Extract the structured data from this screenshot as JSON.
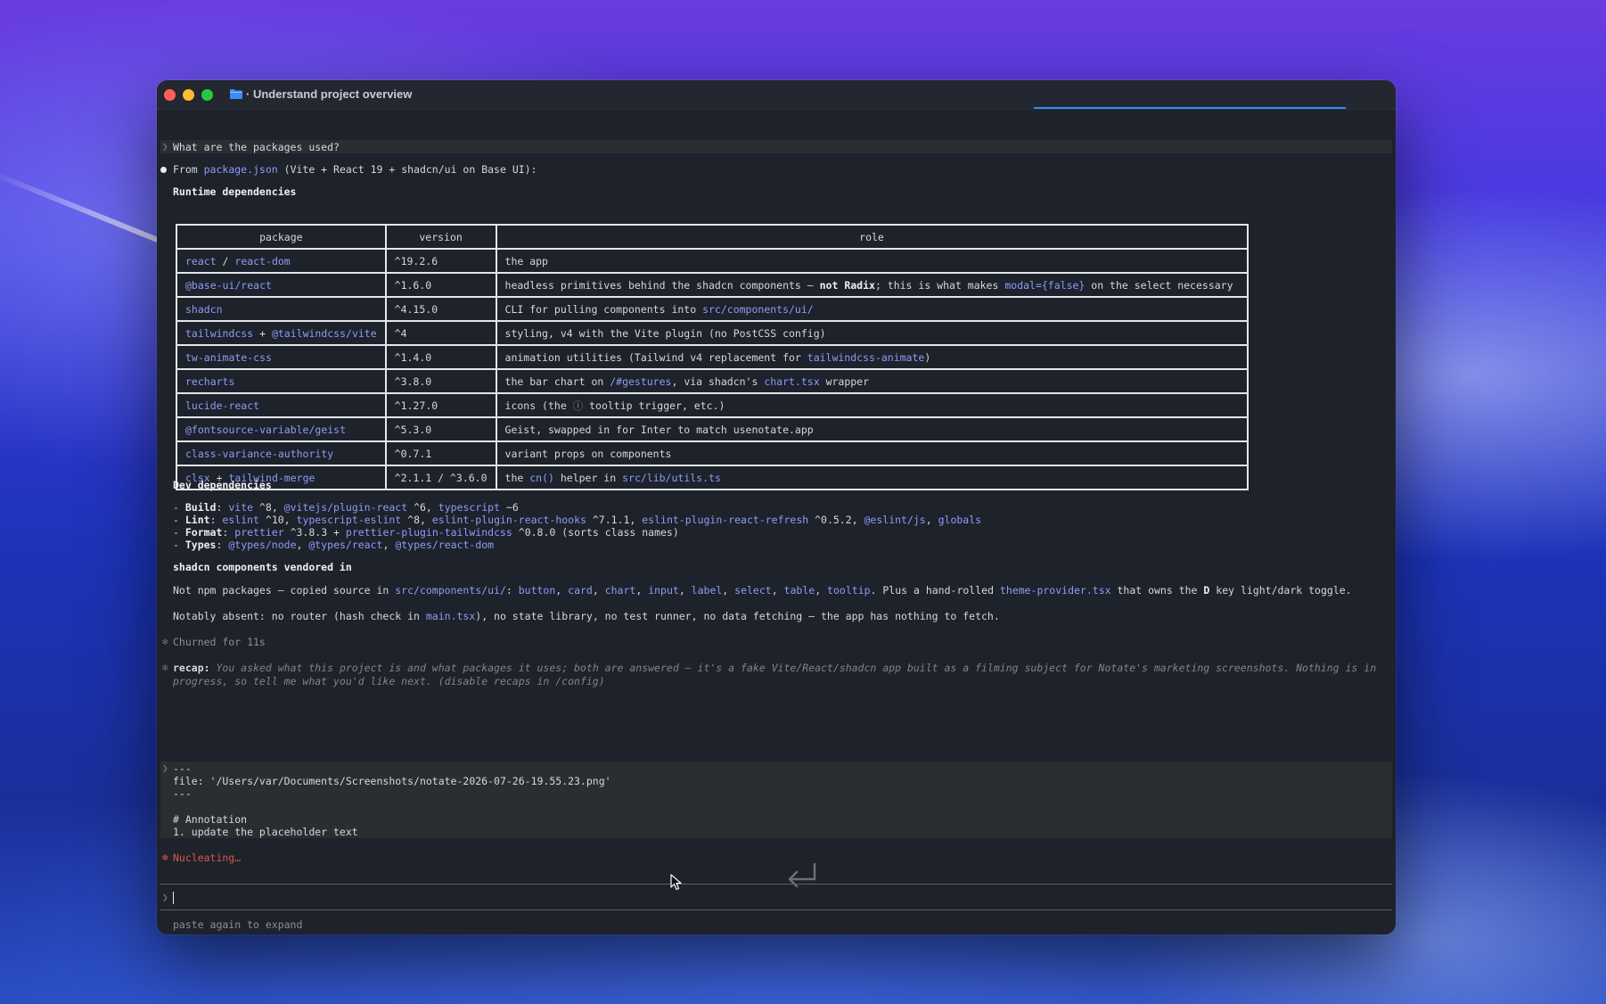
{
  "window": {
    "title": "· Understand project overview"
  },
  "question": "What are the packages used?",
  "intro": {
    "prefix": "From ",
    "file": "package.json",
    "rest": " (Vite + React 19 + shadcn/ui on Base UI):"
  },
  "runtime_heading": "Runtime dependencies",
  "table": {
    "headers": [
      "package",
      "version",
      "role"
    ],
    "rows": [
      {
        "pkg": [
          "react",
          " / ",
          "react-dom"
        ],
        "version": "^19.2.6",
        "role": [
          "the app"
        ]
      },
      {
        "pkg": [
          "@base-ui/react"
        ],
        "version": "^1.6.0",
        "role": [
          "headless primitives behind the shadcn components — ",
          "not Radix",
          "; this is what makes ",
          "modal={false}",
          " on the select necessary"
        ]
      },
      {
        "pkg": [
          "shadcn"
        ],
        "version": "^4.15.0",
        "role": [
          "CLI for pulling components into ",
          "src/components/ui/"
        ]
      },
      {
        "pkg": [
          "tailwindcss",
          " + ",
          "@tailwindcss/vite"
        ],
        "version": "^4",
        "role": [
          "styling, v4 with the Vite plugin (no PostCSS config)"
        ]
      },
      {
        "pkg": [
          "tw-animate-css"
        ],
        "version": "^1.4.0",
        "role": [
          "animation utilities (Tailwind v4 replacement for ",
          "tailwindcss-animate",
          ")"
        ]
      },
      {
        "pkg": [
          "recharts"
        ],
        "version": "^3.8.0",
        "role": [
          "the bar chart on ",
          "/#gestures",
          ", via shadcn's ",
          "chart.tsx",
          " wrapper"
        ]
      },
      {
        "pkg": [
          "lucide-react"
        ],
        "version": "^1.27.0",
        "role": [
          "icons (the ",
          "ⓘ",
          " tooltip trigger, etc.)"
        ]
      },
      {
        "pkg": [
          "@fontsource-variable/geist"
        ],
        "version": "^5.3.0",
        "role": [
          "Geist, swapped in for Inter to match usenotate.app"
        ]
      },
      {
        "pkg": [
          "class-variance-authority"
        ],
        "version": "^0.7.1",
        "role": [
          "variant props on components"
        ]
      },
      {
        "pkg": [
          "clsx",
          " + ",
          "tailwind-merge"
        ],
        "version": "^2.1.1 / ^3.6.0",
        "role": [
          "the ",
          "cn()",
          " helper in ",
          "src/lib/utils.ts"
        ]
      }
    ]
  },
  "dev_heading": "Dev dependencies",
  "dev": {
    "build": {
      "dash": "- ",
      "label": "Build",
      "colon": ": ",
      "p1": "vite",
      "t1": " ^8, ",
      "p2": "@vitejs/plugin-react",
      "t2": " ^6, ",
      "p3": "typescript",
      "t3": " ~6"
    },
    "lint": {
      "dash": "- ",
      "label": "Lint",
      "colon": ": ",
      "p1": "eslint",
      "t1": " ^10, ",
      "p2": "typescript-eslint",
      "t2": " ^8, ",
      "p3": "eslint-plugin-react-hooks",
      "t3": " ^7.1.1, ",
      "p4": "eslint-plugin-react-refresh",
      "t4": " ^0.5.2, ",
      "p5": "@eslint/js",
      "t5": ", ",
      "p6": "globals"
    },
    "format": {
      "dash": "- ",
      "label": "Format",
      "colon": ": ",
      "p1": "prettier",
      "t1": " ^3.8.3 + ",
      "p2": "prettier-plugin-tailwindcss",
      "t2": " ^0.8.0 (sorts class names)"
    },
    "types": {
      "dash": "- ",
      "label": "Types",
      "colon": ": ",
      "p1": "@types/node",
      "t1": ", ",
      "p2": "@types/react",
      "t2": ", ",
      "p3": "@types/react-dom"
    }
  },
  "vendored_heading": "shadcn components vendored in",
  "vendored": {
    "t0": "Not npm packages — copied source in ",
    "dir": "src/components/ui/",
    "t1": ": ",
    "c1": "button",
    "s1": ", ",
    "c2": "card",
    "s2": ", ",
    "c3": "chart",
    "s3": ", ",
    "c4": "input",
    "s4": ", ",
    "c5": "label",
    "s5": ", ",
    "c6": "select",
    "s6": ", ",
    "c7": "table",
    "s7": ", ",
    "c8": "tooltip",
    "t2": ". Plus a hand-rolled ",
    "file": "theme-provider.tsx",
    "t3": " that owns the ",
    "key": "D",
    "t4": " key light/dark toggle."
  },
  "absent": {
    "t0": "Notably absent: no router (hash check in ",
    "file": "main.tsx",
    "t1": "), no state library, no test runner, no data fetching — the app has nothing to fetch."
  },
  "churned": "Churned for 11s",
  "recap": {
    "label": "recap:",
    "text": "You asked what this project is and what packages it uses; both are answered — it's a fake Vite/React/shadcn app built as a filming subject for Notate's marketing screenshots. Nothing is in progress, so tell me what you'd like next. (disable recaps in /config)"
  },
  "pasted": {
    "l1": "---",
    "l2": "file: '/Users/var/Documents/Screenshots/notate-2026-07-26-19.55.23.png'",
    "l3": "---",
    "l4": "# Annotation",
    "l5": "1. update the placeholder text"
  },
  "status": "Nucleating…",
  "hint": "paste again to expand",
  "glyphs": {
    "prompt": "❯",
    "star": "✻",
    "star_red": "✻"
  },
  "colors": {
    "accent_purple": "#8f9cf5",
    "status_red": "#d85a4a",
    "progress_blue": "#2f8cff"
  }
}
